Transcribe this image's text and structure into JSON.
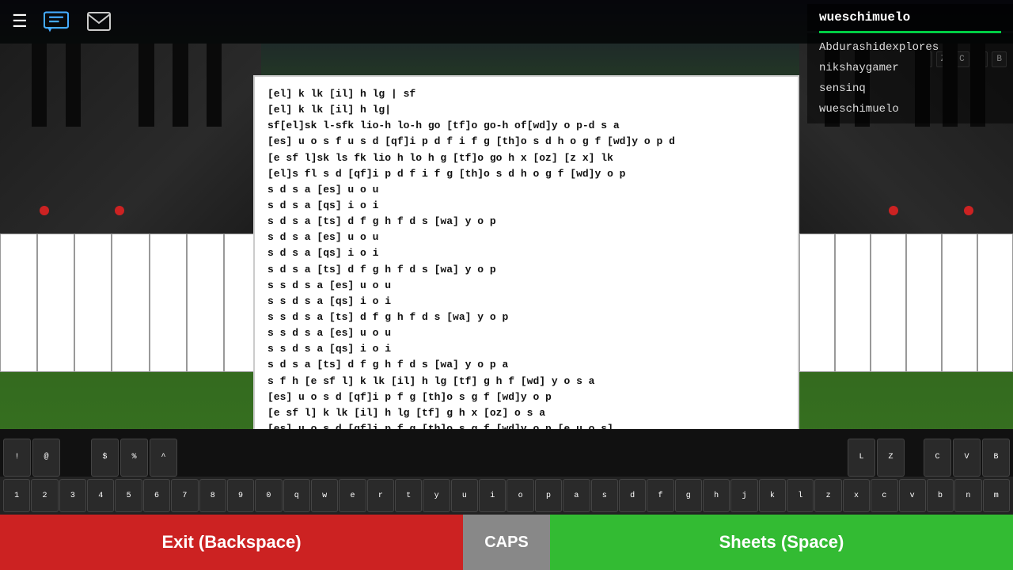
{
  "topbar": {
    "icons": {
      "hamburger": "☰",
      "chat": "chat",
      "mail": "mail"
    }
  },
  "users": {
    "current": "wueschimuelo",
    "list": [
      "Abdurashidexplores",
      "nikshaygamer",
      "sensinq",
      "wueschimuelo"
    ]
  },
  "sheet": {
    "lines": [
      "[el] k lk [il] h lg | sf",
      "[el] k lk [il] h lg|",
      "sf[el]sk l-sfk lio-h lo-h go [tf]o go-h of[wd]y o p-d s a",
      "[es] u o s f u s d [qf]i p d f i f g [th]o s d h o g f [wd]y o p d",
      "[e sf l]sk ls fk lio h lo h g [tf]o go h x [oz] [z x] lk",
      "[el]s fl s d [qf]i p d f i f g [th]o s d h o g f [wd]y o p",
      "s d s a [es] u o u",
      "s d s a [qs] i o i",
      "s d s a [ts] d f g h f d s [wa] y o p",
      "s d s a [es] u o u",
      "s d s a [qs] i o i",
      "s d s a [ts] d f g h f d s [wa] y o p",
      "s s d s a [es] u o u",
      "s s d s a [qs] i o i",
      "s s d s a [ts] d f g h f d s [wa] y o p",
      "s s d s a [es] u o u",
      "s s d s a [qs] i o i",
      "s d s a [ts] d f g h f d s [wa] y o p a",
      "s f h [e sf l] k lk [il] h lg [tf] g h f [wd] y o s a",
      "[es] u o s d [qf]i p f g [th]o s g f [wd]y o p",
      "[e sf l] k lk [il] h lg [tf] g h x [oz] o s a",
      "[es] u o s d [qf]i p f g [th]o s g f [wd]y o p [e u o s]"
    ]
  },
  "keyboard": {
    "symbol_keys": [
      {
        "top": "",
        "bot": "!"
      },
      {
        "top": "",
        "bot": "@"
      },
      {
        "top": "",
        "bot": "$"
      },
      {
        "top": "",
        "bot": "%"
      },
      {
        "top": "",
        "bot": "^"
      }
    ],
    "special_right": [
      "L",
      "Z",
      "C",
      "V",
      "B"
    ],
    "number_row": [
      "1",
      "2",
      "3",
      "4",
      "5",
      "6",
      "7",
      "8",
      "9",
      "0",
      "q",
      "w",
      "e",
      "r",
      "t",
      "y",
      "u",
      "i",
      "o",
      "p",
      "a",
      "s",
      "d",
      "f",
      "g",
      "h",
      "j",
      "k",
      "l",
      "z",
      "x",
      "c",
      "v",
      "b",
      "n",
      "m"
    ]
  },
  "buttons": {
    "exit_label": "Exit (Backspace)",
    "caps_label": "CAPS",
    "sheets_label": "Sheets (Space)"
  }
}
